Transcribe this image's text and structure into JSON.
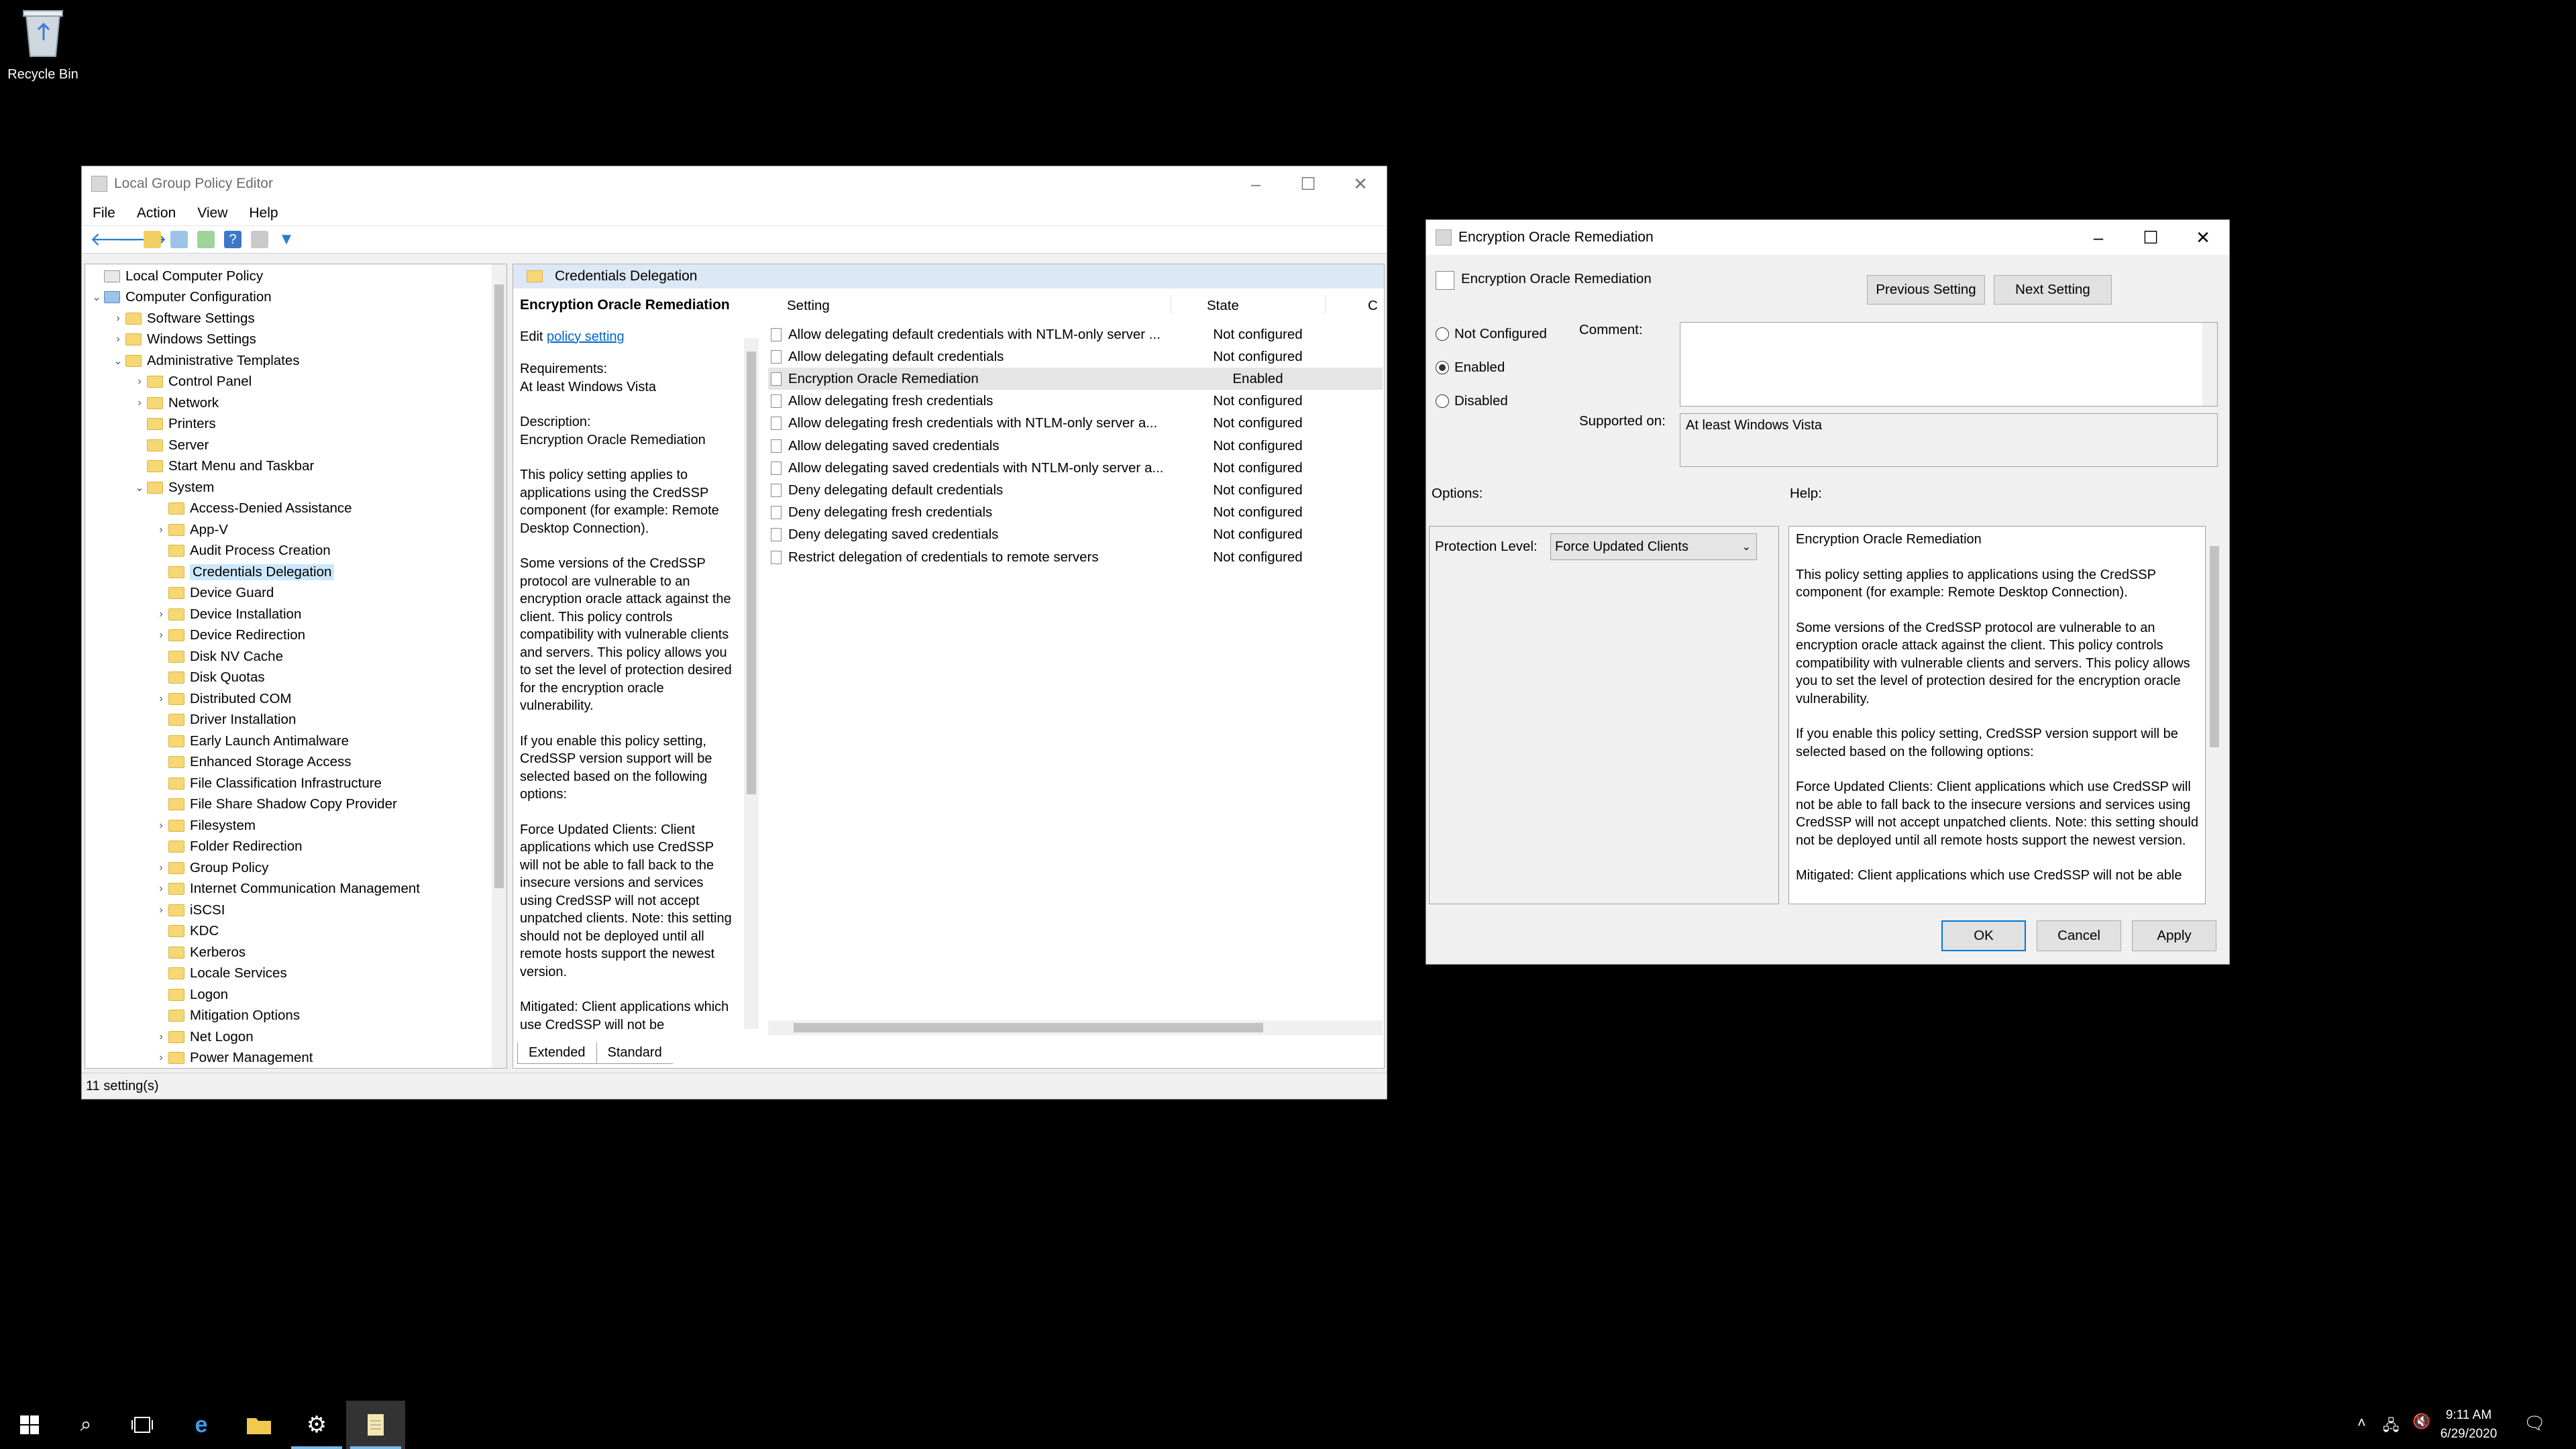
{
  "desktop": {
    "recycle_bin_label": "Recycle Bin"
  },
  "gpe": {
    "title": "Local Group Policy Editor",
    "menu": [
      "File",
      "Action",
      "View",
      "Help"
    ],
    "tree": [
      {
        "label": "Local Computer Policy",
        "level": 0,
        "chevron": ""
      },
      {
        "label": "Computer Configuration",
        "level": 0,
        "chevron": "v"
      },
      {
        "label": "Software Settings",
        "level": 1,
        "chevron": ">"
      },
      {
        "label": "Windows Settings",
        "level": 1,
        "chevron": ">"
      },
      {
        "label": "Administrative Templates",
        "level": 1,
        "chevron": "v"
      },
      {
        "label": "Control Panel",
        "level": 2,
        "chevron": ">"
      },
      {
        "label": "Network",
        "level": 2,
        "chevron": ">"
      },
      {
        "label": "Printers",
        "level": 2,
        "chevron": ""
      },
      {
        "label": "Server",
        "level": 2,
        "chevron": ""
      },
      {
        "label": "Start Menu and Taskbar",
        "level": 2,
        "chevron": ""
      },
      {
        "label": "System",
        "level": 2,
        "chevron": "v"
      },
      {
        "label": "Access-Denied Assistance",
        "level": 3,
        "chevron": ""
      },
      {
        "label": "App-V",
        "level": 3,
        "chevron": ">"
      },
      {
        "label": "Audit Process Creation",
        "level": 3,
        "chevron": ""
      },
      {
        "label": "Credentials Delegation",
        "level": 3,
        "chevron": "",
        "selected": true
      },
      {
        "label": "Device Guard",
        "level": 3,
        "chevron": ""
      },
      {
        "label": "Device Installation",
        "level": 3,
        "chevron": ">"
      },
      {
        "label": "Device Redirection",
        "level": 3,
        "chevron": ">"
      },
      {
        "label": "Disk NV Cache",
        "level": 3,
        "chevron": ""
      },
      {
        "label": "Disk Quotas",
        "level": 3,
        "chevron": ""
      },
      {
        "label": "Distributed COM",
        "level": 3,
        "chevron": ">"
      },
      {
        "label": "Driver Installation",
        "level": 3,
        "chevron": ""
      },
      {
        "label": "Early Launch Antimalware",
        "level": 3,
        "chevron": ""
      },
      {
        "label": "Enhanced Storage Access",
        "level": 3,
        "chevron": ""
      },
      {
        "label": "File Classification Infrastructure",
        "level": 3,
        "chevron": ""
      },
      {
        "label": "File Share Shadow Copy Provider",
        "level": 3,
        "chevron": ""
      },
      {
        "label": "Filesystem",
        "level": 3,
        "chevron": ">"
      },
      {
        "label": "Folder Redirection",
        "level": 3,
        "chevron": ""
      },
      {
        "label": "Group Policy",
        "level": 3,
        "chevron": ">"
      },
      {
        "label": "Internet Communication Management",
        "level": 3,
        "chevron": ">"
      },
      {
        "label": "iSCSI",
        "level": 3,
        "chevron": ">"
      },
      {
        "label": "KDC",
        "level": 3,
        "chevron": ""
      },
      {
        "label": "Kerberos",
        "level": 3,
        "chevron": ""
      },
      {
        "label": "Locale Services",
        "level": 3,
        "chevron": ""
      },
      {
        "label": "Logon",
        "level": 3,
        "chevron": ""
      },
      {
        "label": "Mitigation Options",
        "level": 3,
        "chevron": ""
      },
      {
        "label": "Net Logon",
        "level": 3,
        "chevron": ">"
      },
      {
        "label": "Power Management",
        "level": 3,
        "chevron": ">"
      }
    ],
    "folder_header": "Credentials Delegation",
    "desc": {
      "title": "Encryption Oracle Remediation",
      "edit_prefix": "Edit ",
      "edit_link": "policy setting",
      "req_label": "Requirements:",
      "req_value": "At least Windows Vista",
      "desc_label": "Description:",
      "desc_value": "Encryption Oracle Remediation",
      "p1": "This policy setting applies to applications using the CredSSP component (for example: Remote Desktop Connection).",
      "p2": "Some versions of the CredSSP protocol are vulnerable to an encryption oracle attack against the client.  This policy controls compatibility with vulnerable clients and servers.  This policy allows you to set the level of protection desired for the encryption oracle vulnerability.",
      "p3": "If you enable this policy setting, CredSSP version support will be selected based on the following options:",
      "p4": "Force Updated Clients: Client applications which use CredSSP will not be able to fall back to the insecure versions and services using CredSSP will not accept unpatched clients. Note: this setting should not be deployed until all remote hosts support the newest version.",
      "p5": "Mitigated: Client applications which use CredSSP will not be"
    },
    "columns": {
      "setting": "Setting",
      "state": "State",
      "comment": "C"
    },
    "rows": [
      {
        "setting": "Allow delegating default credentials with NTLM-only server ...",
        "state": "Not configured"
      },
      {
        "setting": "Allow delegating default credentials",
        "state": "Not configured"
      },
      {
        "setting": "Encryption Oracle Remediation",
        "state": "Enabled",
        "highlight": true
      },
      {
        "setting": "Allow delegating fresh credentials",
        "state": "Not configured"
      },
      {
        "setting": "Allow delegating fresh credentials with NTLM-only server a...",
        "state": "Not configured"
      },
      {
        "setting": "Allow delegating saved credentials",
        "state": "Not configured"
      },
      {
        "setting": "Allow delegating saved credentials with NTLM-only server a...",
        "state": "Not configured"
      },
      {
        "setting": "Deny delegating default credentials",
        "state": "Not configured"
      },
      {
        "setting": "Deny delegating fresh credentials",
        "state": "Not configured"
      },
      {
        "setting": "Deny delegating saved credentials",
        "state": "Not configured"
      },
      {
        "setting": "Restrict delegation of credentials to remote servers",
        "state": "Not configured"
      }
    ],
    "tabs": [
      "Extended",
      "Standard"
    ],
    "status": "11 setting(s)"
  },
  "dialog": {
    "title": "Encryption Oracle Remediation",
    "policy_name": "Encryption Oracle Remediation",
    "prev_button": "Previous Setting",
    "next_button": "Next Setting",
    "radios": [
      {
        "label": "Not Configured",
        "checked": false
      },
      {
        "label": "Enabled",
        "checked": true
      },
      {
        "label": "Disabled",
        "checked": false
      }
    ],
    "comment_label": "Comment:",
    "comment_value": "",
    "supported_label": "Supported on:",
    "supported_value": "At least Windows Vista",
    "options_label": "Options:",
    "help_label": "Help:",
    "protection_label": "Protection Level:",
    "protection_value": "Force Updated Clients",
    "help": [
      "Encryption Oracle Remediation",
      "This policy setting applies to applications using the CredSSP component (for example: Remote Desktop Connection).",
      "Some versions of the CredSSP protocol are vulnerable to an encryption oracle attack against the client.  This policy controls compatibility with vulnerable clients and servers.  This policy allows you to set the level of protection desired for the encryption oracle vulnerability.",
      "If you enable this policy setting, CredSSP version support will be selected based on the following options:",
      "Force Updated Clients: Client applications which use CredSSP will not be able to fall back to the insecure versions and services using CredSSP will not accept unpatched clients. Note: this setting should not be deployed until all remote hosts support the newest version.",
      "Mitigated: Client applications which use CredSSP will not be able"
    ],
    "ok": "OK",
    "cancel": "Cancel",
    "apply": "Apply"
  },
  "taskbar": {
    "time": "9:11 AM",
    "date": "6/29/2020",
    "icons": [
      "windows-start-icon",
      "search-icon",
      "task-view-icon",
      "internet-explorer-icon",
      "file-explorer-icon",
      "settings-icon",
      "notepad-icon"
    ]
  }
}
